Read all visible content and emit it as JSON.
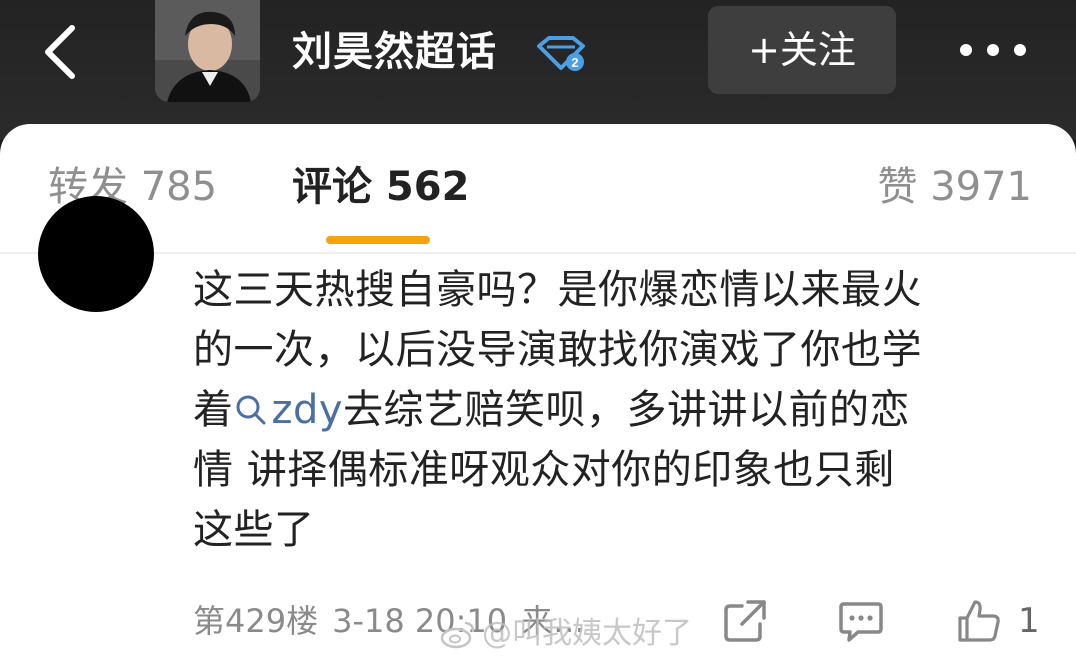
{
  "header": {
    "title": "刘昊然超话",
    "follow_label": "+关注"
  },
  "tabs": [
    {
      "label": "转发 785"
    },
    {
      "label": "评论 562"
    },
    {
      "label": "赞 3971"
    }
  ],
  "comment": {
    "lines": [
      "这三天热搜自豪吗？是你爆恋情以来最火",
      "的一次，以后没导演敢找你演戏了你也学"
    ],
    "line3_prefix": "着",
    "mention": "zdy",
    "line3_suffix": "去综艺赔笑呗，多讲讲以前的恋",
    "line4": "情 讲择偶标准呀观众对你的印象也只剩",
    "line5": "这些了",
    "floor": "第429楼",
    "time": "3-18 20:10",
    "source": "来…",
    "like_count": "1"
  },
  "watermark": "@叫我姨太好了",
  "colors": {
    "tab_underline": "#f7a30d",
    "mention": "#4a6fa5",
    "badge": "#4aa0e6"
  },
  "icons": [
    "back-icon",
    "level-badge-icon",
    "more-icon",
    "share-icon",
    "comment-icon",
    "like-icon",
    "search-icon",
    "weibo-icon"
  ]
}
